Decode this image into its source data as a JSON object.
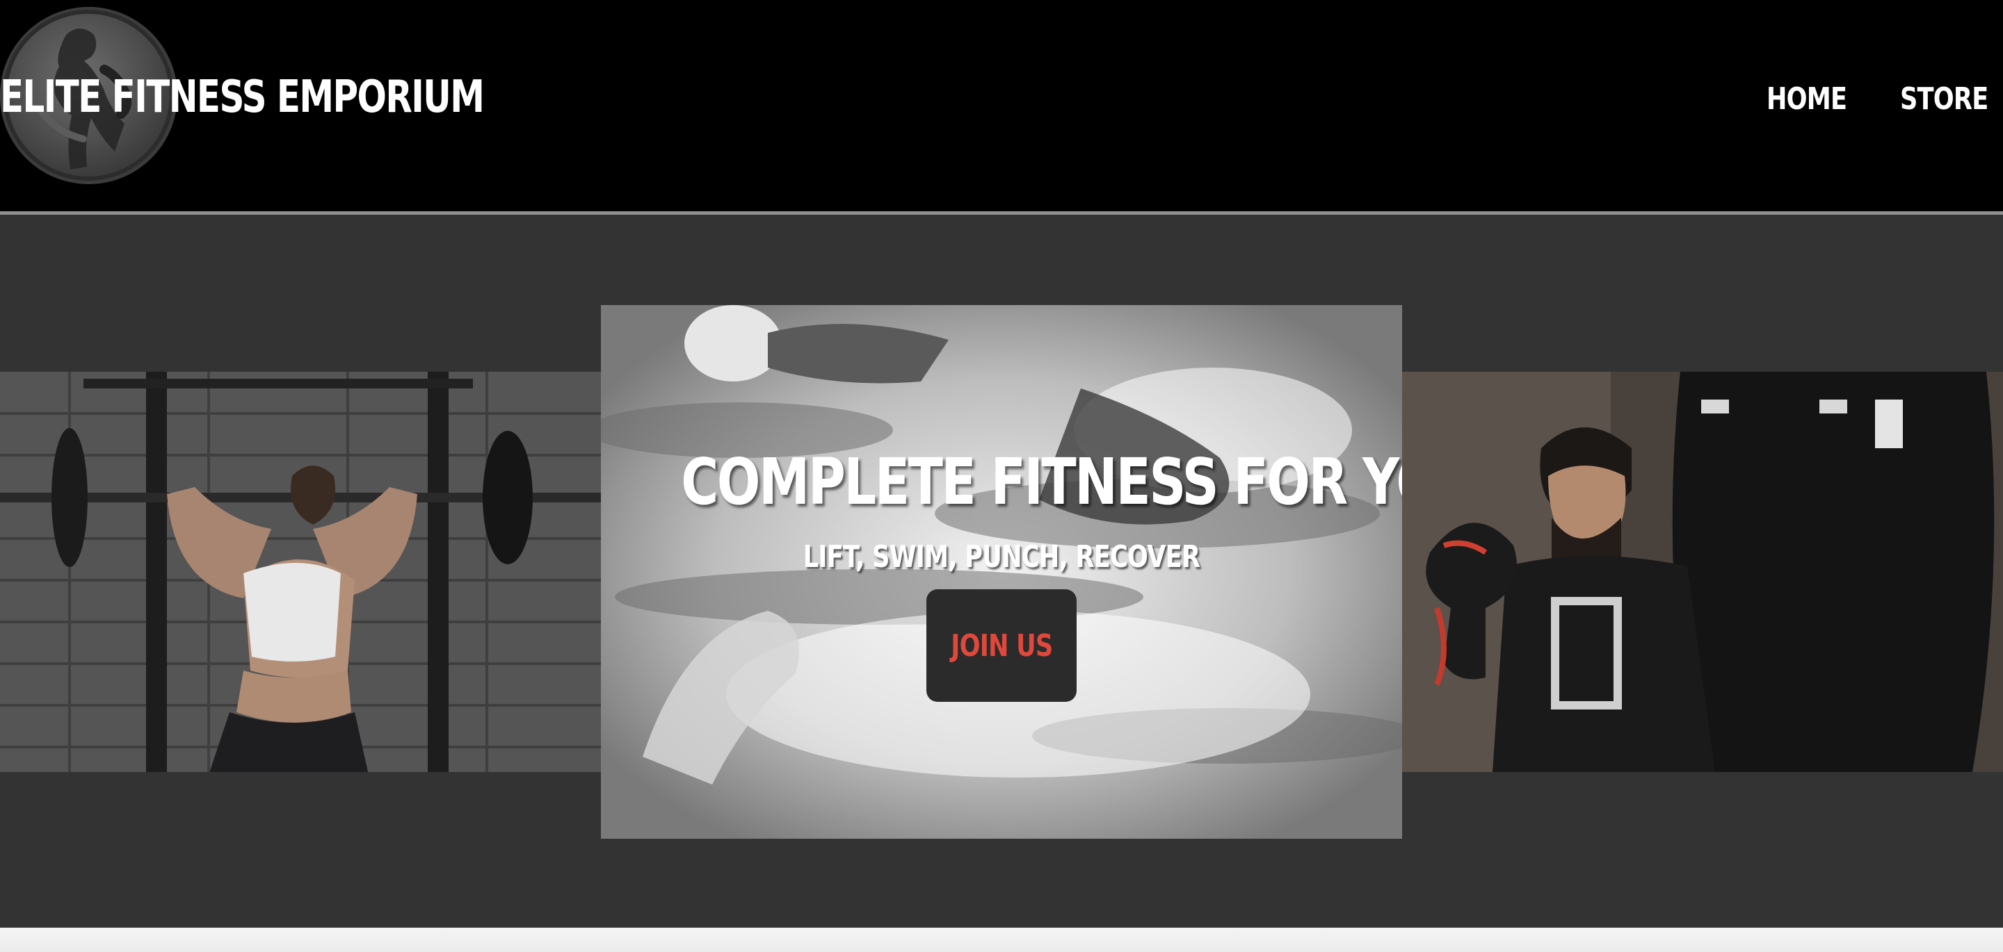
{
  "header": {
    "brand_title": "ELITE FITNESS EMPORIUM",
    "nav": [
      {
        "label": "HOME"
      },
      {
        "label": "STORE"
      }
    ]
  },
  "hero": {
    "title": "COMPLETE FITNESS FOR YOU",
    "subtitle": "LIFT, SWIM, PUNCH, RECOVER",
    "cta_label": "JOIN US",
    "images": {
      "left": "weightlifter-photo",
      "center": "swimmers-photo",
      "right": "boxer-photo"
    }
  },
  "colors": {
    "header_bg": "#000000",
    "hero_bg": "#333333",
    "cta_bg": "#2b2b2b",
    "cta_text": "#e0483b",
    "text": "#ffffff"
  }
}
